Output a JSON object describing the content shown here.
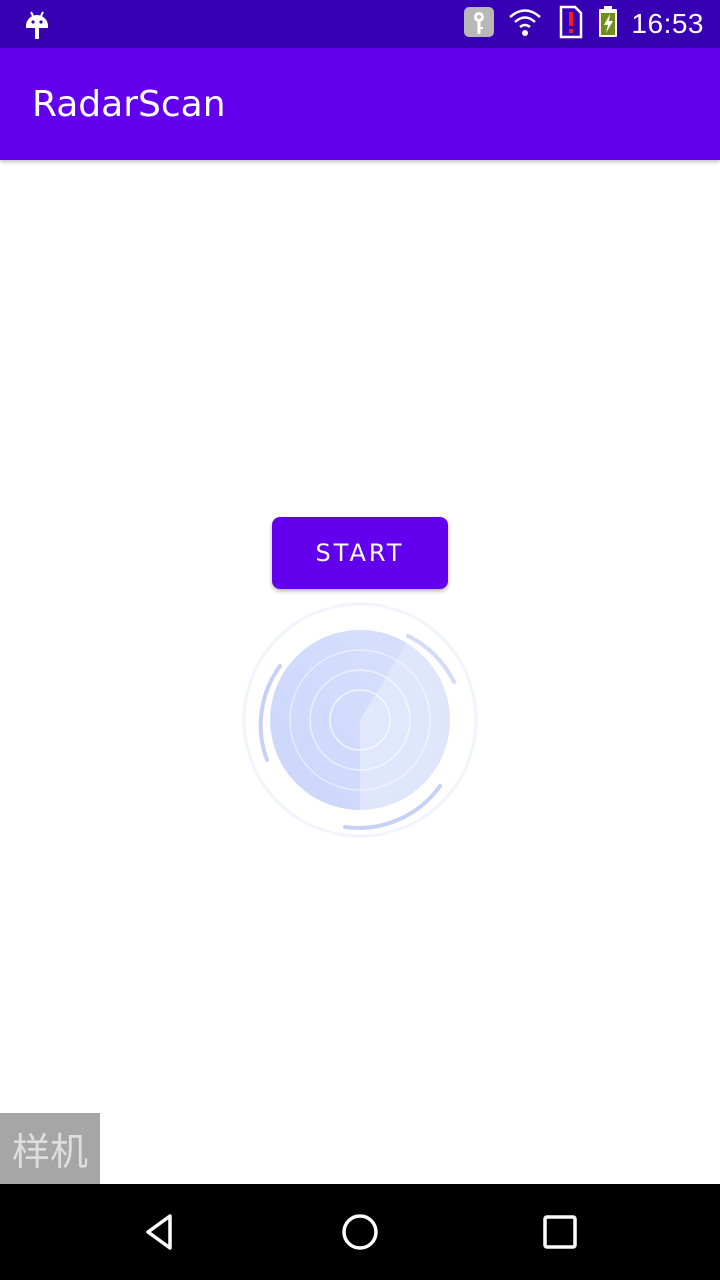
{
  "status_bar": {
    "time": "16:53",
    "icons": [
      "android-icon",
      "key-icon",
      "wifi-icon",
      "sim-alert-icon",
      "battery-charging-icon"
    ]
  },
  "app_bar": {
    "title": "RadarScan"
  },
  "main": {
    "start_label": "START"
  },
  "watermark": {
    "text": "样机"
  },
  "nav_bar": {
    "items": [
      "back-icon",
      "home-icon",
      "recents-icon"
    ]
  },
  "colors": {
    "status_bar": "#3700B3",
    "app_bar": "#6200EE",
    "button": "#6200EE",
    "radar_fill": "#cdd8fb",
    "radar_arc": "#b9c6f5"
  }
}
